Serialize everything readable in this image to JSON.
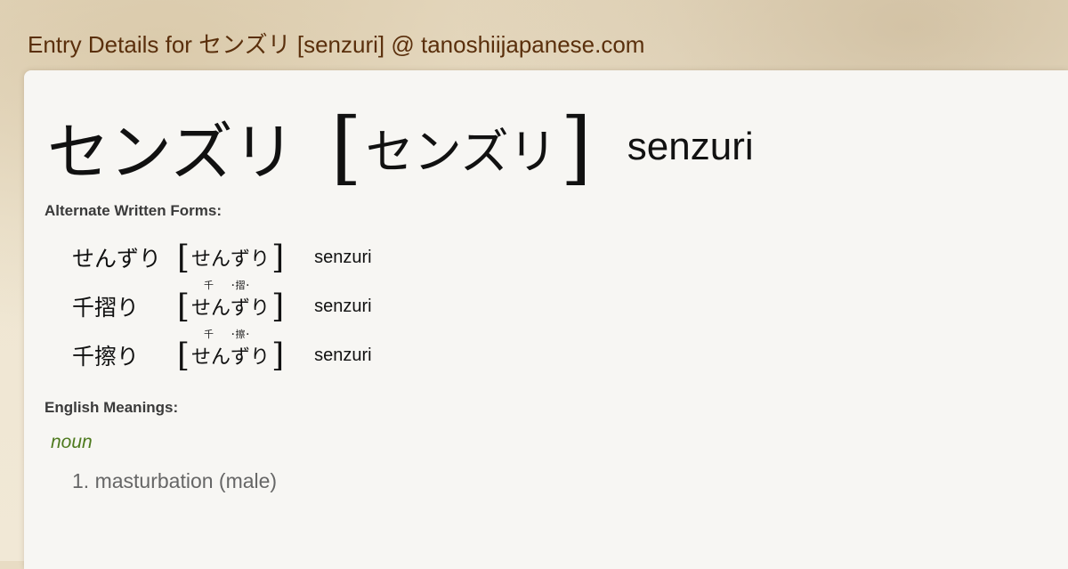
{
  "site_title": "Entry Details for センズリ [senzuri] @ tanoshiijapanese.com",
  "entry": {
    "written": "センズリ",
    "bracket_open": "[",
    "reading": "センズリ",
    "bracket_close": "]",
    "romaji": "senzuri"
  },
  "alternate_label": "Alternate Written Forms:",
  "alternates": [
    {
      "written": "せんずり",
      "reading": "せんずり",
      "romaji": "senzuri",
      "furigana_a": "",
      "furigana_b": ""
    },
    {
      "written": "千摺り",
      "reading": "せんずり",
      "romaji": "senzuri",
      "furigana_a": "千",
      "furigana_b": "･摺･"
    },
    {
      "written": "千擦り",
      "reading": "せんずり",
      "romaji": "senzuri",
      "furigana_a": "千",
      "furigana_b": "･擦･"
    }
  ],
  "meanings_label": "English Meanings:",
  "part_of_speech": "noun",
  "meanings": [
    "1. masturbation (male)"
  ],
  "colors": {
    "title": "#5a2f0c",
    "part_of_speech": "#4e7a1e",
    "panel": "#f7f6f3"
  }
}
